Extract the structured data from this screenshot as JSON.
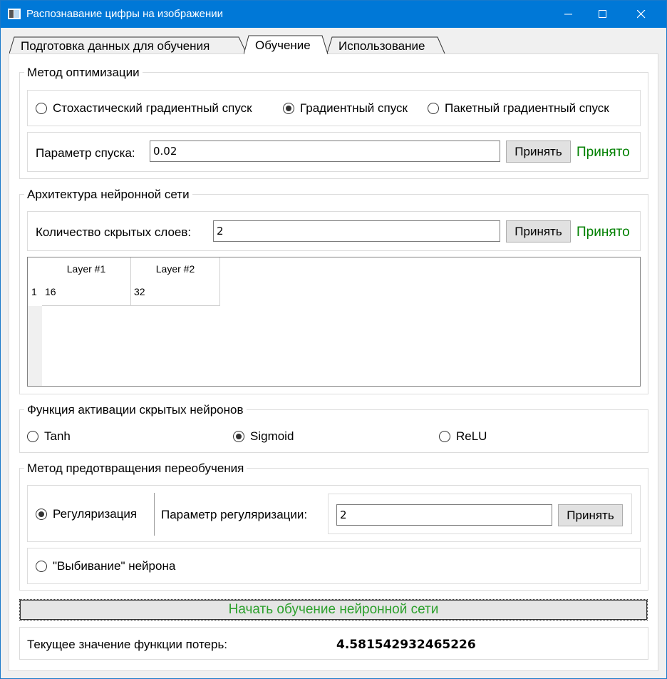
{
  "window": {
    "title": "Распознавание цифры на изображении",
    "accent": "#0078d7"
  },
  "tabs": [
    {
      "label": "Подготовка данных для обучения",
      "selected": false
    },
    {
      "label": "Обучение",
      "selected": true
    },
    {
      "label": "Использование",
      "selected": false
    }
  ],
  "optimization": {
    "group_label": "Метод оптимизации",
    "options": [
      {
        "label": "Стохастический градиентный спуск",
        "checked": false
      },
      {
        "label": "Градиентный спуск",
        "checked": true
      },
      {
        "label": "Пакетный градиентный спуск",
        "checked": false
      }
    ],
    "param_label": "Параметр спуска:",
    "param_value": "0.02",
    "accept_label": "Принять",
    "status": "Принято"
  },
  "architecture": {
    "group_label": "Архитектура нейронной сети",
    "layers_label": "Количество скрытых слоев:",
    "layers_value": "2",
    "accept_label": "Принять",
    "status": "Принято",
    "table": {
      "columns": [
        "Layer #1",
        "Layer #2"
      ],
      "rows": [
        {
          "num": "1",
          "cells": [
            "16",
            "32"
          ]
        }
      ]
    }
  },
  "activation": {
    "group_label": "Функция активации скрытых нейронов",
    "options": [
      {
        "label": "Tanh",
        "checked": false
      },
      {
        "label": "Sigmoid",
        "checked": true
      },
      {
        "label": "ReLU",
        "checked": false
      }
    ]
  },
  "overfitting": {
    "group_label": "Метод предотвращения переобучения",
    "regularization_label": "Регуляризация",
    "regularization_checked": true,
    "reg_param_label": "Параметр регуляризации:",
    "reg_param_value": "2",
    "accept_label": "Принять",
    "dropout_label": "\"Выбивание\" нейрона",
    "dropout_checked": false
  },
  "start_button_label": "Начать обучение нейронной сети",
  "loss": {
    "label": "Текущее значение функции потерь:",
    "value": "4.581542932465226"
  },
  "colors": {
    "accepted": "#008000",
    "start_text": "#2ca02c"
  }
}
